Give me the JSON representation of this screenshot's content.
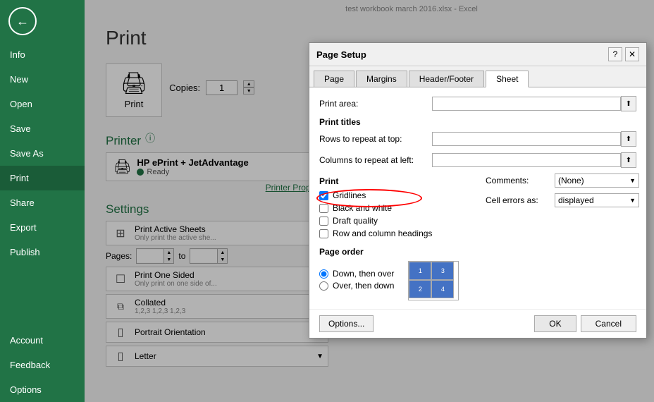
{
  "titlebar": {
    "text": "test workbook march 2016.xlsx - Excel"
  },
  "sidebar": {
    "back_label": "←",
    "items": [
      {
        "id": "info",
        "label": "Info"
      },
      {
        "id": "new",
        "label": "New"
      },
      {
        "id": "open",
        "label": "Open"
      },
      {
        "id": "save",
        "label": "Save"
      },
      {
        "id": "save-as",
        "label": "Save As"
      },
      {
        "id": "print",
        "label": "Print",
        "active": true
      },
      {
        "id": "share",
        "label": "Share"
      },
      {
        "id": "export",
        "label": "Export"
      },
      {
        "id": "publish",
        "label": "Publish"
      }
    ],
    "bottom_items": [
      {
        "id": "account",
        "label": "Account"
      },
      {
        "id": "feedback",
        "label": "Feedback"
      },
      {
        "id": "options",
        "label": "Options"
      }
    ]
  },
  "main": {
    "title": "Print",
    "copies_label": "Copies:",
    "copies_value": "1",
    "printer_section": "Printer",
    "printer_name": "HP ePrint + JetAdvantage",
    "printer_status": "Ready",
    "printer_properties": "Printer Properties",
    "settings_section": "Settings",
    "settings": [
      {
        "label": "Print Active Sheets",
        "sub": "Only print the active she...",
        "icon": "⊞"
      },
      {
        "label": "Print One Sided",
        "sub": "Only print on one side of...",
        "icon": "☐"
      },
      {
        "label": "Collated",
        "sub": "1,2,3   1,2,3   1,2,3",
        "icon": "⧉"
      },
      {
        "label": "Portrait Orientation",
        "sub": "",
        "icon": "▯"
      },
      {
        "label": "Letter",
        "sub": "",
        "icon": "▯"
      }
    ],
    "pages_label": "Pages:",
    "pages_to": "to"
  },
  "dialog": {
    "title": "Page Setup",
    "help_label": "?",
    "close_label": "✕",
    "tabs": [
      {
        "label": "Page"
      },
      {
        "label": "Margins"
      },
      {
        "label": "Header/Footer"
      },
      {
        "label": "Sheet",
        "active": true
      }
    ],
    "print_area_label": "Print area:",
    "print_titles_label": "Print titles",
    "rows_label": "Rows to repeat at top:",
    "cols_label": "Columns to repeat at left:",
    "print_section_label": "Print",
    "checkboxes": [
      {
        "label": "Gridlines",
        "checked": true
      },
      {
        "label": "Black and white",
        "checked": false
      },
      {
        "label": "Draft quality",
        "checked": false
      },
      {
        "label": "Row and column headings",
        "checked": false
      }
    ],
    "comments_label": "Comments:",
    "comments_value": "(None)",
    "cell_errors_label": "Cell errors as:",
    "cell_errors_value": "displayed",
    "page_order_label": "Page order",
    "page_order_options": [
      {
        "label": "Down, then over",
        "selected": true
      },
      {
        "label": "Over, then down",
        "selected": false
      }
    ],
    "options_btn": "Options...",
    "ok_btn": "OK",
    "cancel_btn": "Cancel"
  }
}
